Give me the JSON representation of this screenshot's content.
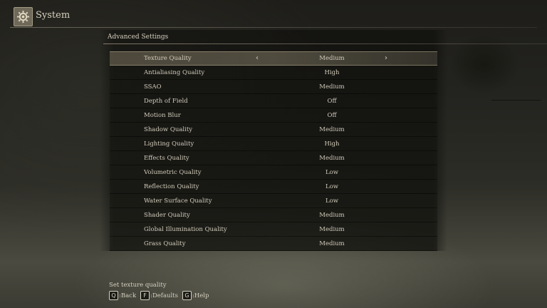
{
  "header": {
    "title": "System",
    "icon": "gear-icon"
  },
  "section": {
    "title": "Advanced Settings"
  },
  "settings": [
    {
      "label": "Texture Quality",
      "value": "Medium"
    },
    {
      "label": "Antialiasing Quality",
      "value": "High"
    },
    {
      "label": "SSAO",
      "value": "Medium"
    },
    {
      "label": "Depth of Field",
      "value": "Off"
    },
    {
      "label": "Motion Blur",
      "value": "Off"
    },
    {
      "label": "Shadow Quality",
      "value": "Medium"
    },
    {
      "label": "Lighting Quality",
      "value": "High"
    },
    {
      "label": "Effects Quality",
      "value": "Medium"
    },
    {
      "label": "Volumetric Quality",
      "value": "Low"
    },
    {
      "label": "Reflection Quality",
      "value": "Low"
    },
    {
      "label": "Water Surface Quality",
      "value": "Low"
    },
    {
      "label": "Shader Quality",
      "value": "Medium"
    },
    {
      "label": "Global Illumination Quality",
      "value": "Medium"
    },
    {
      "label": "Grass Quality",
      "value": "Medium"
    }
  ],
  "selected_index": 0,
  "footer": {
    "description": "Set texture quality",
    "hints": [
      {
        "key": "Q",
        "label": ":Back"
      },
      {
        "key": "F",
        "label": ":Defaults"
      },
      {
        "key": "G",
        "label": ":Help"
      }
    ]
  }
}
